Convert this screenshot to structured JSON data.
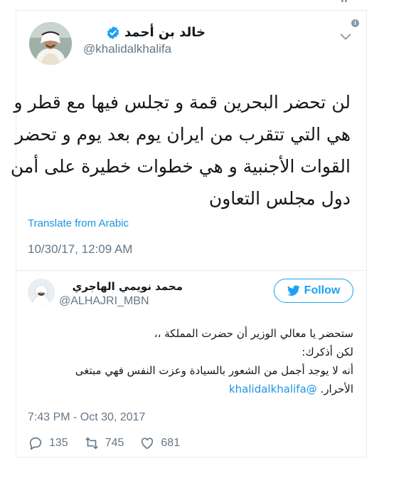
{
  "main_tweet": {
    "display_name": "خالد بن أحمد",
    "handle": "@khalidalkhalifa",
    "text_lines": [
      "لن تحضر البحرين قمة و تجلس فيها مع قطر و",
      "هي التي تتقرب من ايران يوم بعد يوم و تحضر",
      "القوات الأجنبية و هي خطوات خطيرة على أمن",
      "دول مجلس التعاون"
    ],
    "translate_label": "Translate from Arabic",
    "timestamp": "10/30/17, 12:09 AM"
  },
  "reply_tweet": {
    "display_name": "محمد نويمي الهاجري",
    "handle": "@ALHAJRI_MBN",
    "follow_label": "Follow",
    "text_lines": [
      "ستحضر يا معالي الوزير أن حضرت المملكة ،،",
      "لكن أذكرك:",
      "أنه لا يوجد أجمل من الشعور بالسيادة وعزت النفس فهي مبتغى"
    ],
    "last_line_text": "الأحرار.",
    "mention": "@khalidalkhalifa",
    "timestamp": "7:43 PM - Oct 30, 2017",
    "replies": "135",
    "retweets": "745",
    "likes": "681"
  },
  "icons": {
    "verified": "verified-badge-icon",
    "caret": "chevron-down-icon",
    "info": "info-icon",
    "follow": "twitter-bird-icon",
    "reply": "reply-icon",
    "retweet": "retweet-icon",
    "like": "heart-icon"
  },
  "colors": {
    "accent": "#1da1f2",
    "link": "#1b95e0",
    "muted": "#657786",
    "text": "#14171a",
    "border": "#e6ecf0"
  }
}
